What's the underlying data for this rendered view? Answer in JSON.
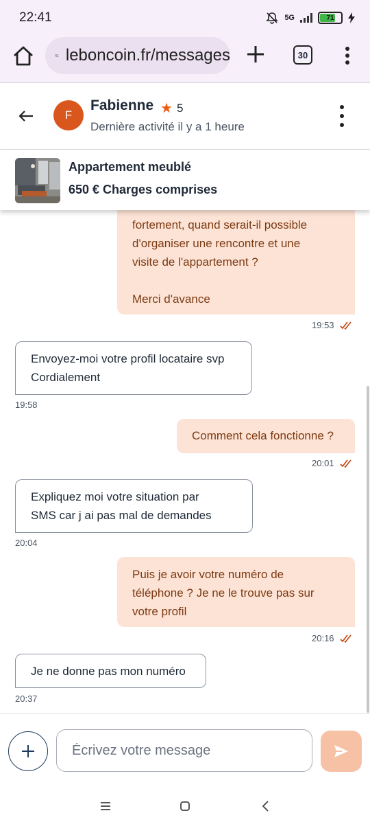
{
  "status_bar": {
    "time": "22:41",
    "network": "5G",
    "battery": "71"
  },
  "browser": {
    "url": "leboncoin.fr/messages",
    "tab_count": "30"
  },
  "conversation": {
    "avatar_letter": "F",
    "name": "Fabienne",
    "rating": "5",
    "activity": "Dernière activité il y a 1 heure"
  },
  "ad": {
    "title": "Appartement meublé",
    "price": "650 €  Charges comprises"
  },
  "messages": [
    {
      "direction": "out",
      "lines": [
        "fortement, quand serait-il possible",
        "d'organiser une rencontre et une",
        "visite de l'appartement ?",
        "",
        "Merci d'avance"
      ],
      "time": "19:53"
    },
    {
      "direction": "in",
      "lines": [
        "Envoyez-moi votre profil locataire svp",
        "Cordialement"
      ],
      "time": "19:58"
    },
    {
      "direction": "out",
      "lines": [
        "Comment cela fonctionne ?"
      ],
      "time": "20:01"
    },
    {
      "direction": "in",
      "lines": [
        "Expliquez moi votre situation par",
        "SMS car j ai pas mal de demandes"
      ],
      "time": "20:04"
    },
    {
      "direction": "out",
      "lines": [
        "Puis je avoir votre numéro de",
        "téléphone ? Je ne le trouve pas sur",
        "votre profil"
      ],
      "time": "20:16"
    },
    {
      "direction": "in",
      "lines": [
        "Je ne donne pas mon numéro"
      ],
      "time": "20:37"
    }
  ],
  "composer": {
    "placeholder": "Écrivez votre message"
  },
  "colors": {
    "accent": "#ec5a13",
    "out_bubble": "#fde3d5",
    "avatar": "#d9571c",
    "send": "#f7c1a6"
  }
}
